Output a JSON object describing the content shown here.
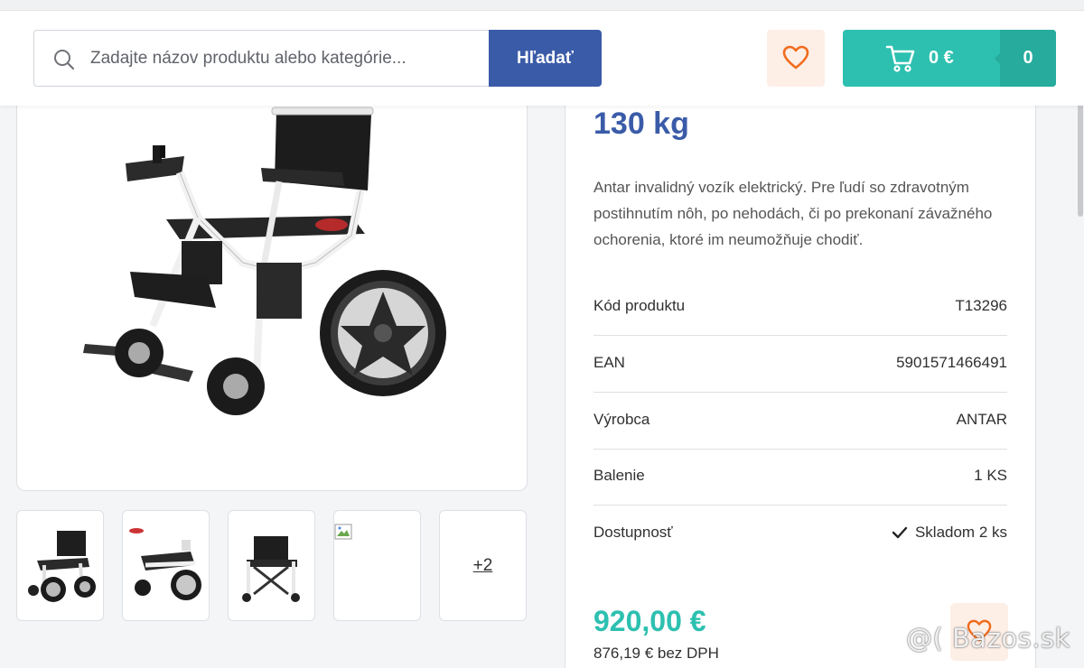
{
  "search": {
    "placeholder": "Zadajte názov produktu alebo kategórie...",
    "button_label": "Hľadať"
  },
  "header": {
    "cart_price": "0 €",
    "cart_count": "0",
    "brand_color": "#3a5ba8",
    "accent_color": "#2dc0b0",
    "favorite_bg": "#fdeee6"
  },
  "gallery": {
    "more_label": "+2"
  },
  "product": {
    "weight_line": "130 kg",
    "description": "Antar invalidný vozík elektrický. Pre ľudí so zdravotným postihnutím nôh, po nehodách, či po prekonaní závažného ochorenia, ktoré im neumožňuje chodiť.",
    "specs": [
      {
        "label": "Kód produktu",
        "value": "T13296"
      },
      {
        "label": "EAN",
        "value": "5901571466491"
      },
      {
        "label": "Výrobca",
        "value": "ANTAR"
      },
      {
        "label": "Balenie",
        "value": "1 KS"
      },
      {
        "label": "Dostupnosť",
        "value": "Skladom 2 ks"
      }
    ],
    "price": "920,00 €",
    "price_net": "876,19 € bez DPH"
  },
  "watermark": "@( Bazos.sk",
  "icons": [
    "search-icon",
    "heart-icon",
    "cart-icon",
    "check-icon",
    "broken-image-icon"
  ]
}
